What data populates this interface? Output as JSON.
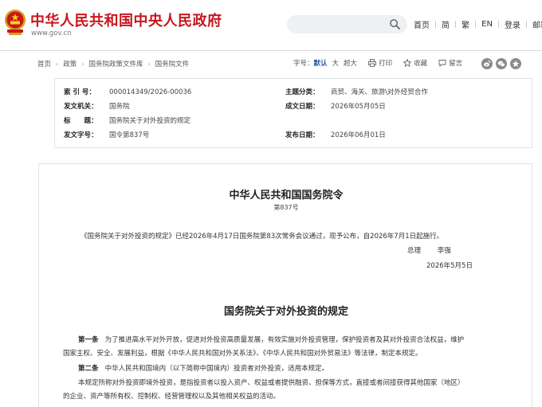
{
  "header": {
    "site_name": "中华人民共和国中央人民政府",
    "site_url": "www.gov.cn",
    "links": [
      "首页",
      "简",
      "繁",
      "EN",
      "登录",
      "邮箱"
    ]
  },
  "breadcrumb": [
    "首页",
    "政策",
    "国务院政策文件库",
    "国务院文件"
  ],
  "tools": {
    "font_size_label": "字号：",
    "font_default": "默认",
    "font_large": "大",
    "font_xlarge": "超大",
    "print": "打印",
    "favorite": "收藏",
    "comment": "留言"
  },
  "info": {
    "index_label": "索 引 号：",
    "index_value": "000014349/2026-00036",
    "topic_label": "主题分类：",
    "topic_value": "商贸、海关、旅游\\对外经贸合作",
    "issuer_label": "发文机关：",
    "issuer_value": "国务院",
    "date_label": "成文日期：",
    "date_value": "2026年05月05日",
    "title_label": "标　　题：",
    "title_value": "国务院关于对外投资的规定",
    "docno_label": "发文字号：",
    "docno_value": "国令第837号",
    "publish_label": "发布日期：",
    "publish_value": "2026年06月01日"
  },
  "document": {
    "order_title": "中华人民共和国国务院令",
    "order_number": "第837号",
    "intro": "《国务院关于对外投资的规定》已经2026年4月17日国务院第83次常务会议通过，现予公布，自2026年7月1日起施行。",
    "signer_title": "总理",
    "signer_name": "李强",
    "sign_date": "2026年5月5日",
    "reg_title": "国务院关于对外投资的规定",
    "art1_label": "第一条",
    "art1_line1": "为了推进高水平对外开放，促进对外投资高质量发展，有效实施对外投资管理，保护投资者及其对外投资合法权益，维护",
    "art1_line2": "国家主权、安全、发展利益，根据《中华人民共和国对外关系法》、《中华人民共和国对外贸易法》等法律，制定本规定。",
    "art2_label": "第二条",
    "art2_line1": "中华人民共和国境内（以下简称中国境内）投资者对外投资，适用本规定。",
    "art2_line2": "本规定所称对外投资即境外投资，是指投资者以投入资产、权益或者提供融资、担保等方式，直接或者间接获得其他国家（地区）",
    "art2_line3": "的企业、资产等所有权、控制权、经营管理权以及其他相关权益的活动。"
  }
}
